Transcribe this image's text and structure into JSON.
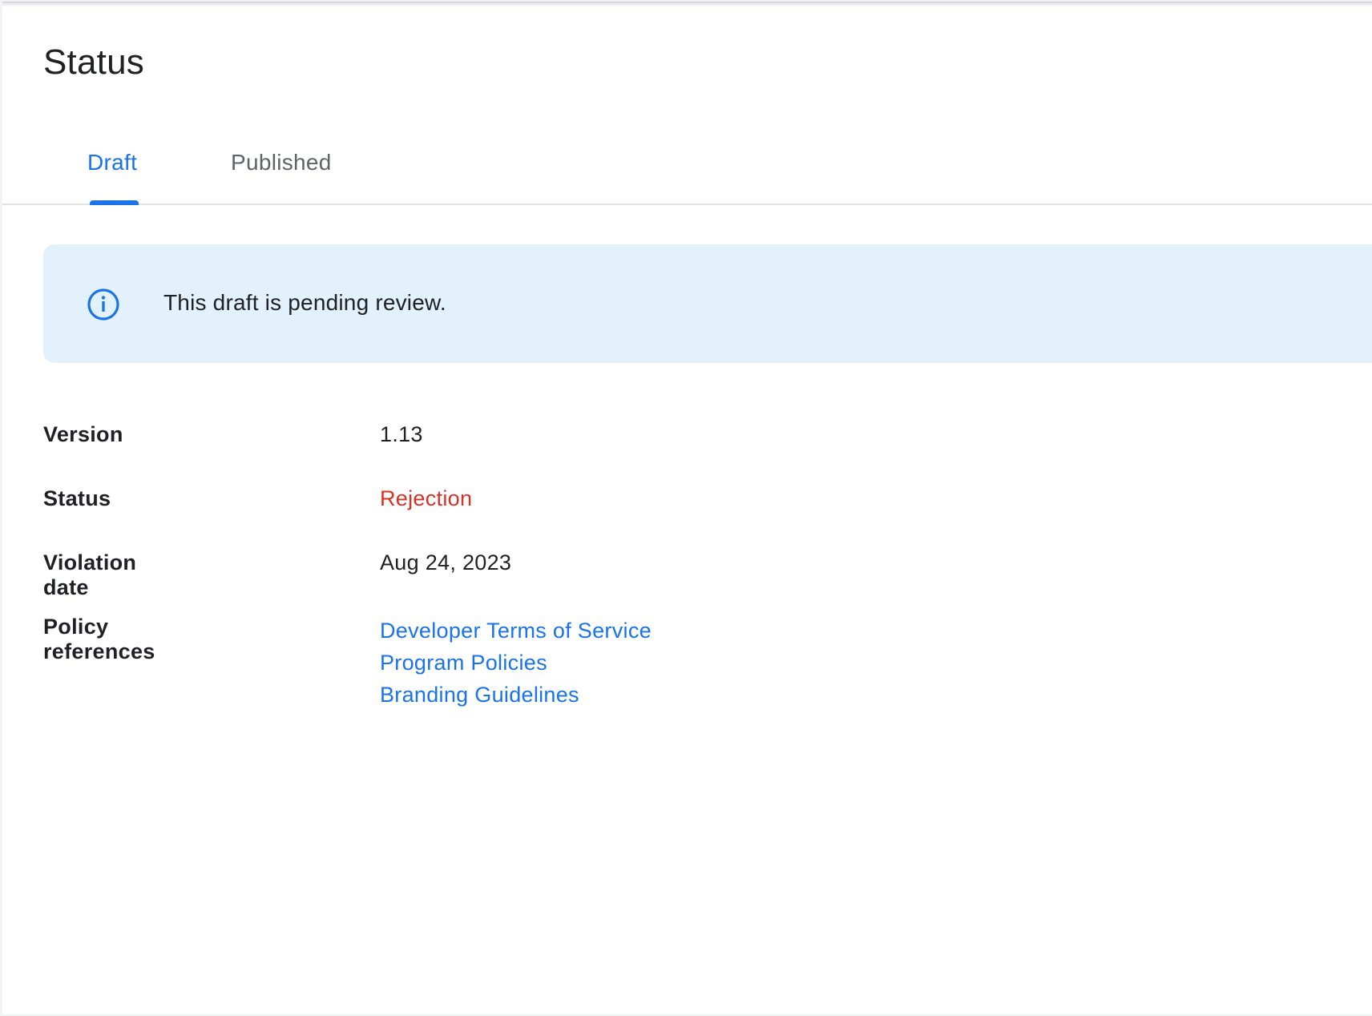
{
  "page": {
    "title": "Status"
  },
  "tabs": [
    {
      "label": "Draft",
      "active": true
    },
    {
      "label": "Published",
      "active": false
    }
  ],
  "banner": {
    "icon": "info-icon",
    "message": "This draft is pending review."
  },
  "details": {
    "version": {
      "label": "Version",
      "value": "1.13"
    },
    "status": {
      "label": "Status",
      "value": "Rejection"
    },
    "violation_date": {
      "label": "Violation date",
      "value": "Aug 24, 2023"
    },
    "policy_references": {
      "label": "Policy references",
      "links": [
        "Developer Terms of Service",
        "Program Policies",
        "Branding Guidelines"
      ]
    }
  },
  "colors": {
    "accent": "#1a73e8",
    "error": "#d93025",
    "banner_bg": "#e3f1fc",
    "text": "#202124"
  }
}
